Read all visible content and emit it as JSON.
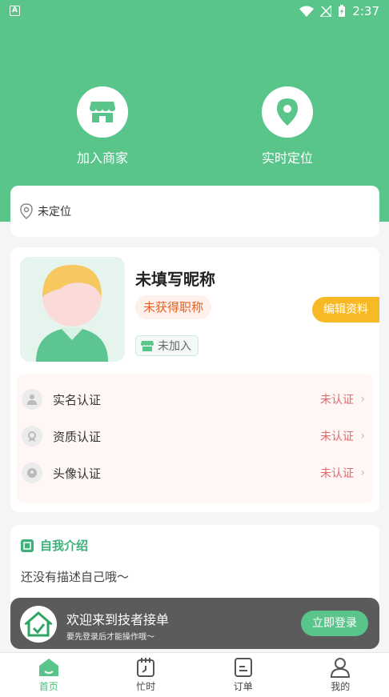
{
  "status_bar": {
    "time": "2:37",
    "app_letter": "A"
  },
  "header": {
    "actions": [
      {
        "label": "加入商家",
        "icon": "shop-icon"
      },
      {
        "label": "实时定位",
        "icon": "location-pin-icon"
      }
    ]
  },
  "location": {
    "text": "未定位"
  },
  "profile": {
    "nickname": "未填写昵称",
    "title_badge": "未获得职称",
    "join_status": "未加入",
    "edit_label": "编辑资料",
    "certifications": [
      {
        "label": "实名认证",
        "status": "未认证"
      },
      {
        "label": "资质认证",
        "status": "未认证"
      },
      {
        "label": "头像认证",
        "status": "未认证"
      }
    ]
  },
  "intro": {
    "title": "自我介绍",
    "text": "还没有描述自己哦～"
  },
  "login_prompt": {
    "title": "欢迎来到技者接单",
    "subtitle": "要先登录后才能操作哦～",
    "button": "立即登录"
  },
  "tabs": [
    {
      "label": "首页",
      "active": true
    },
    {
      "label": "忙时",
      "active": false
    },
    {
      "label": "订单",
      "active": false
    },
    {
      "label": "我的",
      "active": false
    }
  ],
  "colors": {
    "primary": "#5ac58a",
    "edit": "#f7b926",
    "warning": "#e26a6a",
    "title_badge": "#e0632a"
  }
}
